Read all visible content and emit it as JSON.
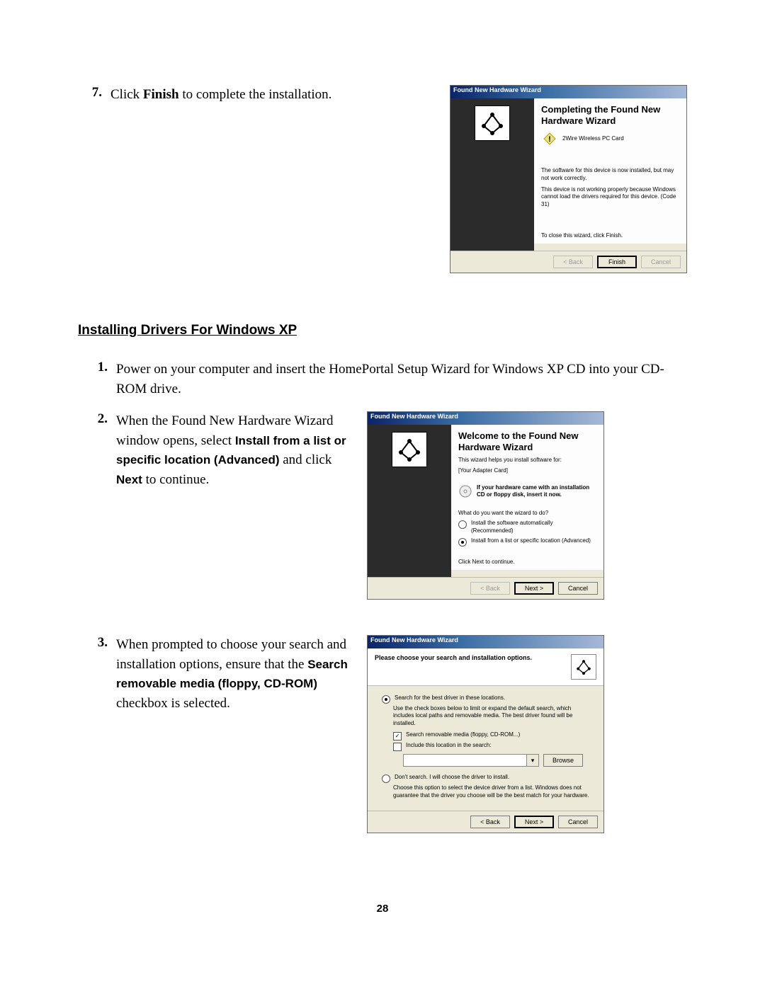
{
  "step7": {
    "num": "7.",
    "text_pre": "Click ",
    "text_bold": "Finish",
    "text_post": " to complete the installation."
  },
  "wizard1": {
    "title": "Found New Hardware Wizard",
    "heading": "Completing the Found New Hardware Wizard",
    "device": "2Wire Wireless PC Card",
    "msg1": "The software for this device is now installed, but may not work correctly.",
    "msg2": "This device is not working properly because Windows cannot load the drivers required for this device. (Code 31)",
    "close_hint": "To close this wizard, click Finish.",
    "back": "< Back",
    "finish": "Finish",
    "cancel": "Cancel"
  },
  "section_heading": "Installing Drivers For Windows XP",
  "step1": {
    "num": "1.",
    "text": "Power on your computer and insert the HomePortal Setup Wizard for Windows XP CD into your CD-ROM drive."
  },
  "step2": {
    "num": "2.",
    "pre": "When the Found New Hardware Wizard window opens, select ",
    "bold1": "Install from a list or specific location (Advanced)",
    "mid": " and click ",
    "bold2": "Next",
    "post": " to continue."
  },
  "wizard2": {
    "title": "Found New Hardware Wizard",
    "heading": "Welcome to the Found New Hardware Wizard",
    "help_line": "This wizard helps you install software for:",
    "device": "[Your Adapter Card]",
    "cd_hint": "If your hardware came with an installation CD or floppy disk, insert it now.",
    "question": "What do you want the wizard to do?",
    "opt1": "Install the software automatically (Recommended)",
    "opt2": "Install from a list or specific location (Advanced)",
    "cont": "Click Next to continue.",
    "back": "< Back",
    "next": "Next >",
    "cancel": "Cancel"
  },
  "step3": {
    "num": "3.",
    "pre": "When prompted to choose your search and installation options, ensure that the ",
    "bold": "Search removable media (floppy, CD-ROM)",
    "post": " checkbox is selected."
  },
  "wizard3": {
    "title": "Found New Hardware Wizard",
    "header": "Please choose your search and installation options.",
    "opt_search": "Search for the best driver in these locations.",
    "search_sub": "Use the check boxes below to limit or expand the default search, which includes local paths and removable media. The best driver found will be installed.",
    "chk_removable": "Search removable media (floppy, CD-ROM...)",
    "chk_include": "Include this location in the search:",
    "browse": "Browse",
    "opt_dont": "Don't search. I will choose the driver to install.",
    "dont_sub": "Choose this option to select the device driver from a list. Windows does not guarantee that the driver you choose will be the best match for your hardware.",
    "back": "< Back",
    "next": "Next >",
    "cancel": "Cancel"
  },
  "page_number": "28"
}
